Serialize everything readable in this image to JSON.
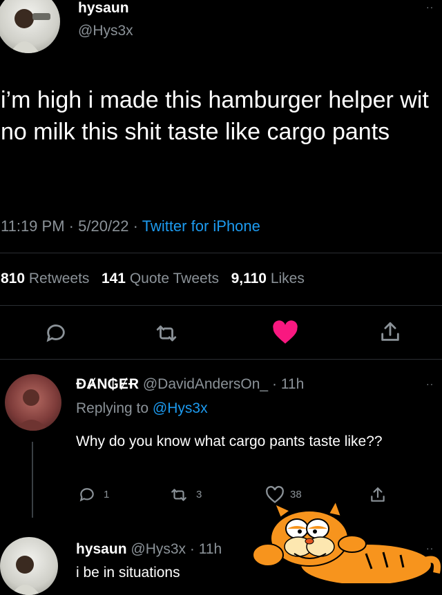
{
  "main_tweet": {
    "display_name": "hysaun",
    "handle": "@Hys3x",
    "text": "i’m high i made this hamburger helper wit no milk this shit taste like cargo pants",
    "time": "11:19 PM",
    "date": "5/20/22",
    "separator": "·",
    "source": "Twitter for iPhone",
    "stats": {
      "retweets_count": "810",
      "retweets_label": "Retweets",
      "quotes_count": "141",
      "quotes_label": "Quote Tweets",
      "likes_count": "9,110",
      "likes_label": "Likes"
    },
    "liked": true,
    "like_color": "#f91880"
  },
  "reply": {
    "display_name": "ĐȺN₲ɆɌ",
    "handle": "@DavidAndersOn_",
    "time": "· 11h",
    "replying_prefix": "Replying to",
    "replying_handle": "@Hys3x",
    "text": "Why do you know what cargo pants taste like??",
    "reply_count": "1",
    "retweet_count": "3",
    "like_count": "38"
  },
  "reply2": {
    "display_name": "hysaun",
    "handle": "@Hys3x",
    "time": "· 11h",
    "text": "i be in situations"
  },
  "colors": {
    "accent": "#1d9bf0",
    "muted": "#8b9298",
    "background": "#000000",
    "sticker_orange": "#f7941d"
  }
}
